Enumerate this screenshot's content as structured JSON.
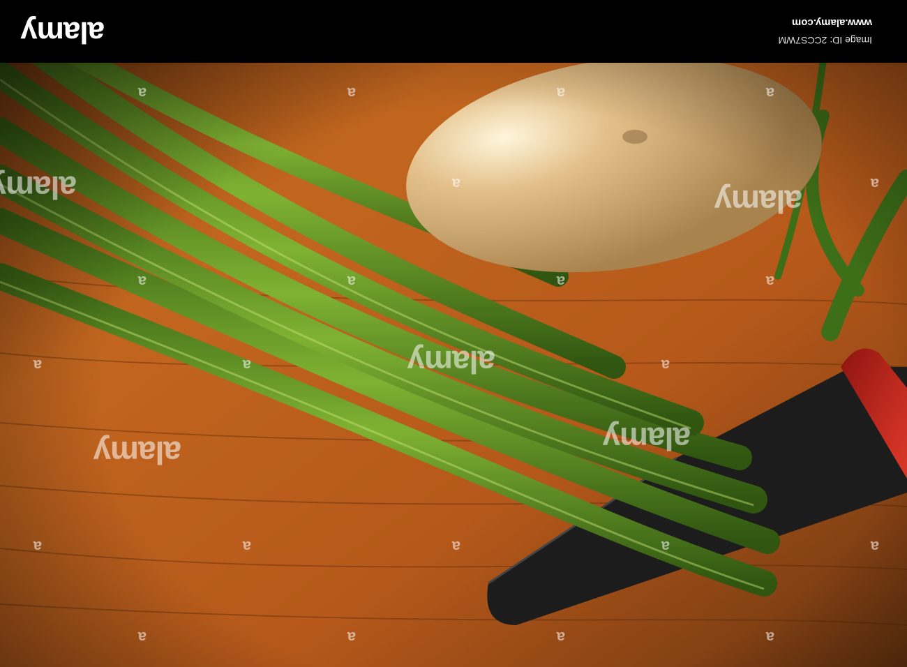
{
  "photo": {
    "subject": "",
    "colors": {
      "wood": "#b5581a",
      "wood_dark": "#5a2a0c",
      "bean": "#4f7f1e",
      "bean_light": "#8fbf3a",
      "potato": "#d8b07a",
      "knife_blade": "#1b1b1b",
      "knife_handle": "#c4201c"
    }
  },
  "banner": {
    "logo": "alamy",
    "site": "www.alamy.com",
    "image_id": "Image ID: 2CCS7WM"
  },
  "watermark": {
    "text_big": "alamy",
    "text_small": "a"
  }
}
